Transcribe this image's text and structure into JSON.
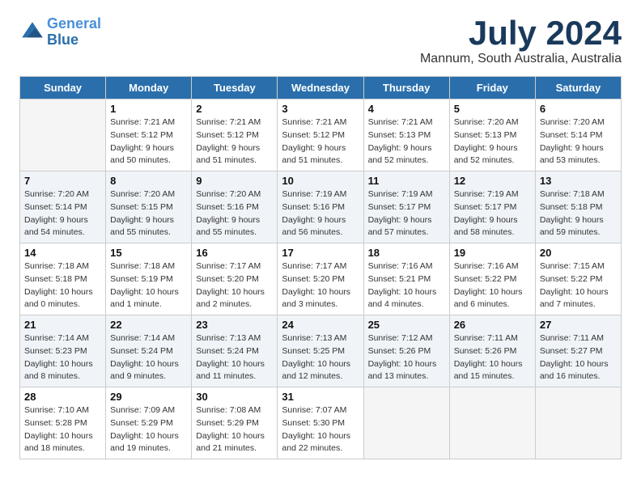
{
  "header": {
    "logo_line1": "General",
    "logo_line2": "Blue",
    "month": "July 2024",
    "location": "Mannum, South Australia, Australia"
  },
  "days_of_week": [
    "Sunday",
    "Monday",
    "Tuesday",
    "Wednesday",
    "Thursday",
    "Friday",
    "Saturday"
  ],
  "weeks": [
    [
      {
        "day": "",
        "sunrise": "",
        "sunset": "",
        "daylight": ""
      },
      {
        "day": "1",
        "sunrise": "Sunrise: 7:21 AM",
        "sunset": "Sunset: 5:12 PM",
        "daylight": "Daylight: 9 hours and 50 minutes."
      },
      {
        "day": "2",
        "sunrise": "Sunrise: 7:21 AM",
        "sunset": "Sunset: 5:12 PM",
        "daylight": "Daylight: 9 hours and 51 minutes."
      },
      {
        "day": "3",
        "sunrise": "Sunrise: 7:21 AM",
        "sunset": "Sunset: 5:12 PM",
        "daylight": "Daylight: 9 hours and 51 minutes."
      },
      {
        "day": "4",
        "sunrise": "Sunrise: 7:21 AM",
        "sunset": "Sunset: 5:13 PM",
        "daylight": "Daylight: 9 hours and 52 minutes."
      },
      {
        "day": "5",
        "sunrise": "Sunrise: 7:20 AM",
        "sunset": "Sunset: 5:13 PM",
        "daylight": "Daylight: 9 hours and 52 minutes."
      },
      {
        "day": "6",
        "sunrise": "Sunrise: 7:20 AM",
        "sunset": "Sunset: 5:14 PM",
        "daylight": "Daylight: 9 hours and 53 minutes."
      }
    ],
    [
      {
        "day": "7",
        "sunrise": "Sunrise: 7:20 AM",
        "sunset": "Sunset: 5:14 PM",
        "daylight": "Daylight: 9 hours and 54 minutes."
      },
      {
        "day": "8",
        "sunrise": "Sunrise: 7:20 AM",
        "sunset": "Sunset: 5:15 PM",
        "daylight": "Daylight: 9 hours and 55 minutes."
      },
      {
        "day": "9",
        "sunrise": "Sunrise: 7:20 AM",
        "sunset": "Sunset: 5:16 PM",
        "daylight": "Daylight: 9 hours and 55 minutes."
      },
      {
        "day": "10",
        "sunrise": "Sunrise: 7:19 AM",
        "sunset": "Sunset: 5:16 PM",
        "daylight": "Daylight: 9 hours and 56 minutes."
      },
      {
        "day": "11",
        "sunrise": "Sunrise: 7:19 AM",
        "sunset": "Sunset: 5:17 PM",
        "daylight": "Daylight: 9 hours and 57 minutes."
      },
      {
        "day": "12",
        "sunrise": "Sunrise: 7:19 AM",
        "sunset": "Sunset: 5:17 PM",
        "daylight": "Daylight: 9 hours and 58 minutes."
      },
      {
        "day": "13",
        "sunrise": "Sunrise: 7:18 AM",
        "sunset": "Sunset: 5:18 PM",
        "daylight": "Daylight: 9 hours and 59 minutes."
      }
    ],
    [
      {
        "day": "14",
        "sunrise": "Sunrise: 7:18 AM",
        "sunset": "Sunset: 5:18 PM",
        "daylight": "Daylight: 10 hours and 0 minutes."
      },
      {
        "day": "15",
        "sunrise": "Sunrise: 7:18 AM",
        "sunset": "Sunset: 5:19 PM",
        "daylight": "Daylight: 10 hours and 1 minute."
      },
      {
        "day": "16",
        "sunrise": "Sunrise: 7:17 AM",
        "sunset": "Sunset: 5:20 PM",
        "daylight": "Daylight: 10 hours and 2 minutes."
      },
      {
        "day": "17",
        "sunrise": "Sunrise: 7:17 AM",
        "sunset": "Sunset: 5:20 PM",
        "daylight": "Daylight: 10 hours and 3 minutes."
      },
      {
        "day": "18",
        "sunrise": "Sunrise: 7:16 AM",
        "sunset": "Sunset: 5:21 PM",
        "daylight": "Daylight: 10 hours and 4 minutes."
      },
      {
        "day": "19",
        "sunrise": "Sunrise: 7:16 AM",
        "sunset": "Sunset: 5:22 PM",
        "daylight": "Daylight: 10 hours and 6 minutes."
      },
      {
        "day": "20",
        "sunrise": "Sunrise: 7:15 AM",
        "sunset": "Sunset: 5:22 PM",
        "daylight": "Daylight: 10 hours and 7 minutes."
      }
    ],
    [
      {
        "day": "21",
        "sunrise": "Sunrise: 7:14 AM",
        "sunset": "Sunset: 5:23 PM",
        "daylight": "Daylight: 10 hours and 8 minutes."
      },
      {
        "day": "22",
        "sunrise": "Sunrise: 7:14 AM",
        "sunset": "Sunset: 5:24 PM",
        "daylight": "Daylight: 10 hours and 9 minutes."
      },
      {
        "day": "23",
        "sunrise": "Sunrise: 7:13 AM",
        "sunset": "Sunset: 5:24 PM",
        "daylight": "Daylight: 10 hours and 11 minutes."
      },
      {
        "day": "24",
        "sunrise": "Sunrise: 7:13 AM",
        "sunset": "Sunset: 5:25 PM",
        "daylight": "Daylight: 10 hours and 12 minutes."
      },
      {
        "day": "25",
        "sunrise": "Sunrise: 7:12 AM",
        "sunset": "Sunset: 5:26 PM",
        "daylight": "Daylight: 10 hours and 13 minutes."
      },
      {
        "day": "26",
        "sunrise": "Sunrise: 7:11 AM",
        "sunset": "Sunset: 5:26 PM",
        "daylight": "Daylight: 10 hours and 15 minutes."
      },
      {
        "day": "27",
        "sunrise": "Sunrise: 7:11 AM",
        "sunset": "Sunset: 5:27 PM",
        "daylight": "Daylight: 10 hours and 16 minutes."
      }
    ],
    [
      {
        "day": "28",
        "sunrise": "Sunrise: 7:10 AM",
        "sunset": "Sunset: 5:28 PM",
        "daylight": "Daylight: 10 hours and 18 minutes."
      },
      {
        "day": "29",
        "sunrise": "Sunrise: 7:09 AM",
        "sunset": "Sunset: 5:29 PM",
        "daylight": "Daylight: 10 hours and 19 minutes."
      },
      {
        "day": "30",
        "sunrise": "Sunrise: 7:08 AM",
        "sunset": "Sunset: 5:29 PM",
        "daylight": "Daylight: 10 hours and 21 minutes."
      },
      {
        "day": "31",
        "sunrise": "Sunrise: 7:07 AM",
        "sunset": "Sunset: 5:30 PM",
        "daylight": "Daylight: 10 hours and 22 minutes."
      },
      {
        "day": "",
        "sunrise": "",
        "sunset": "",
        "daylight": ""
      },
      {
        "day": "",
        "sunrise": "",
        "sunset": "",
        "daylight": ""
      },
      {
        "day": "",
        "sunrise": "",
        "sunset": "",
        "daylight": ""
      }
    ]
  ]
}
